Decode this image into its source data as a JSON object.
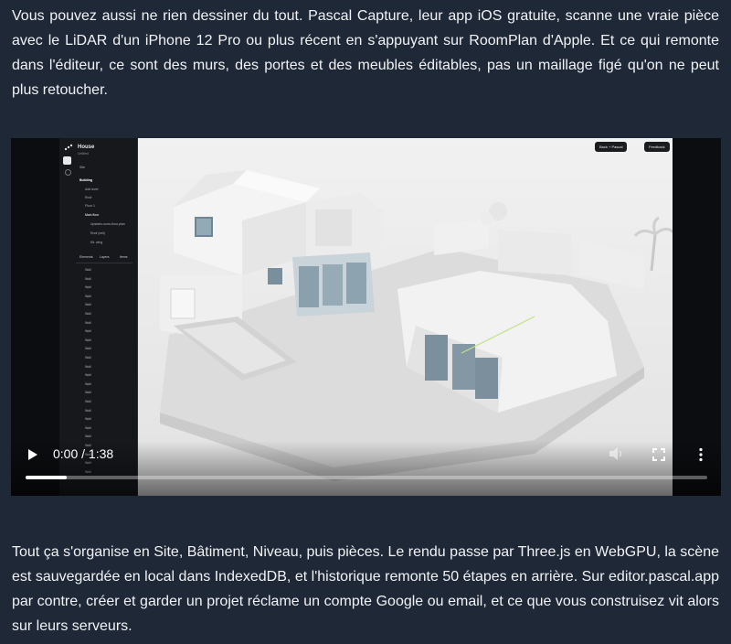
{
  "article": {
    "paragraph_1": "Vous pouvez aussi ne rien dessiner du tout. Pascal Capture, leur app iOS gratuite, scanne une vraie pièce avec le LiDAR d'un iPhone 12 Pro ou plus récent en s'appuyant sur RoomPlan d'Apple. Et ce qui remonte dans l'éditeur, ce sont des murs, des portes et des meubles éditables, pas un maillage figé qu'on ne peut plus retoucher.",
    "paragraph_2": "Tout ça s'organise en Site, Bâtiment, Niveau, puis pièces. Le rendu passe par Three.js en WebGPU, la scène est sauvegardée en local dans IndexedDB, et l'historique remonte 50 étapes en arrière. Sur editor.pascal.app par contre, créer et garder un projet réclame un compte Google ou email, et ce que vous construisez vit alors sur leurs serveurs."
  },
  "video": {
    "time_display": "0:00 / 1:38",
    "progress": 0.06,
    "play_icon": "play-icon",
    "volume_icon": "volume-icon",
    "fullscreen_icon": "fullscreen-icon",
    "menu_icon": "more-vert-icon"
  },
  "editor": {
    "project_title": "House",
    "project_sub": "Untitled",
    "tree": {
      "site": "Site",
      "building": "Building",
      "add_level": "Add level",
      "roof": "Roof",
      "floor": "Floor 1",
      "main_floor": "Main floor",
      "room_1": "Upstairs-room-floor-plan",
      "room_2": "Roof (ceil)",
      "room_3": "Kit. wing"
    },
    "tabs": [
      "Elements",
      "Layers",
      "Items"
    ],
    "wall_label": "Wall",
    "share_button": "Back + Pascal",
    "feedback_button": "Feedback"
  }
}
